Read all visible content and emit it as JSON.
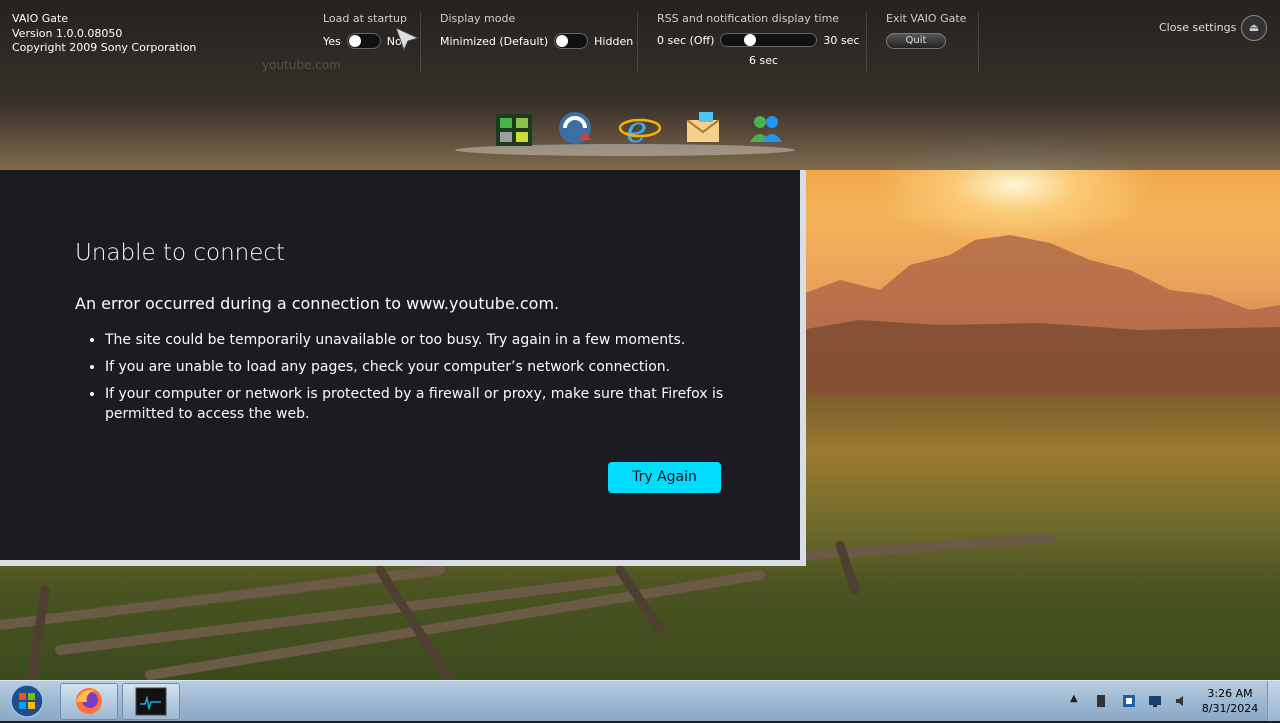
{
  "gate": {
    "app_title": "VAIO Gate",
    "version": "Version 1.0.0.08050",
    "copyright": "Copyright 2009 Sony Corporation",
    "load_startup": {
      "label": "Load at startup",
      "yes": "Yes",
      "no": "No"
    },
    "display_mode": {
      "label": "Display mode",
      "minimized": "Minimized (Default)",
      "hidden": "Hidden"
    },
    "rss": {
      "label": "RSS and notification display time",
      "min": "0 sec (Off)",
      "max": "30 sec",
      "value": "6 sec",
      "value_seconds": 6
    },
    "exit": {
      "label": "Exit VAIO Gate",
      "quit": "Quit"
    },
    "close_settings": "Close settings",
    "ghost_url": "youtube.com",
    "dock_icons": [
      "media-gallery-icon",
      "vaio-update-icon",
      "internet-explorer-icon",
      "email-icon",
      "windows-live-messenger-icon"
    ]
  },
  "error": {
    "title": "Unable to connect",
    "subtitle": "An error occurred during a connection to www.youtube.com.",
    "bullets": [
      "The site could be temporarily unavailable or too busy. Try again in a few moments.",
      "If you are unable to load any pages, check your computer’s network connection.",
      "If your computer or network is protected by a firewall or proxy, make sure that Firefox is permitted to access the web."
    ],
    "try_again": "Try Again"
  },
  "taskbar": {
    "time": "3:26 AM",
    "date": "8/31/2024",
    "pinned": [
      "firefox-icon",
      "terminal-icon"
    ],
    "tray_icons": [
      "show-hidden-icons-arrow",
      "usb-device-icon",
      "network-icon",
      "display-icon",
      "volume-icon"
    ]
  },
  "colors": {
    "error_bg": "#1c1b22",
    "button_accent": "#00ddff",
    "taskbar": "#9fb9d3"
  }
}
